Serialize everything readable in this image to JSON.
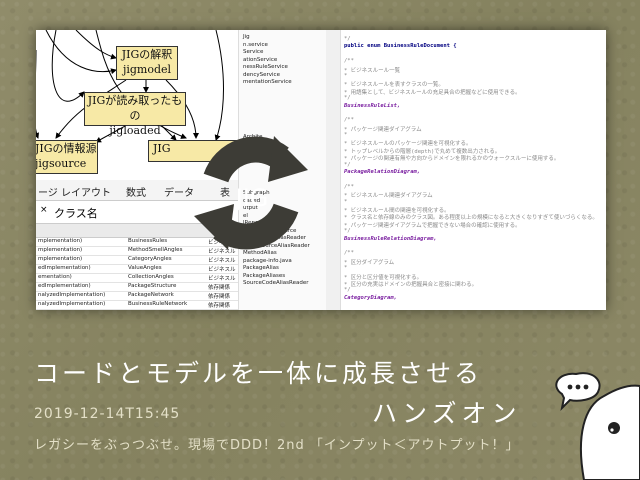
{
  "slide": {
    "title": "コードとモデルを一体に成長させる",
    "handson": "ハンズオン",
    "date": "2019-12-14T15:45",
    "subtitle": "レガシーをぶっつぶせ。現場でDDD！2nd 「インプット＜アウトプット！」",
    "logo_text": "JIG",
    "logo_color": "#3d3c36"
  },
  "diagram": {
    "nodes": [
      "JIGの解釈",
      "jigmodel",
      "JIGが読み取ったもの",
      "jigloaded",
      "JIGの情報源",
      "jigsource",
      "JIG"
    ]
  },
  "excel": {
    "ribbon": [
      "ージ レイアウト",
      "数式",
      "データ",
      "表示"
    ],
    "namebox_text": "クラス名",
    "rows": [
      [
        "mplementation)",
        "BusinessRules",
        "ビジネスル"
      ],
      [
        "mplementation)",
        "MethodSmellAngles",
        "ビジネスル"
      ],
      [
        "mplementation)",
        "CategoryAngles",
        "ビジネスル"
      ],
      [
        "edImplementation)",
        "ValueAngles",
        "ビジネスル"
      ],
      [
        "ementation)",
        "CollectionAngles",
        "ビジネスル"
      ],
      [
        "edImplementation)",
        "PackageStructure",
        "依存関係"
      ],
      [
        "nalyzedImplementation)",
        "PackageNetwork",
        "依存関係"
      ],
      [
        "nalyzedImplementation)",
        "BusinessRuleNetwork",
        "依存関係"
      ]
    ]
  },
  "tree": {
    "top": [
      "Jig",
      "n.service",
      "Service",
      "ationService",
      "nessRuleService",
      "dencyService",
      "mentationService"
    ],
    "middle": [
      "Archite",
      "BusinessRu",
      "DotText"
    ],
    "bottom": [
      "Subgraph",
      "oaded",
      "utput",
      "el",
      "lRepository",
      "JavadocAliasSource",
      "JavaSourceAliasReader",
      "KotlinSourceAliasReader",
      "MethodAlias",
      "package-info.java",
      "PackageAlias",
      "PackageAliases",
      "SourceCodeAliasReader"
    ]
  },
  "code": {
    "lines": [
      {
        "t": "*/",
        "c": "cm"
      },
      {
        "t": "public enum BusinessRuleDocument {",
        "c": "kw"
      },
      {
        "t": "",
        "c": ""
      },
      {
        "t": "/**",
        "c": "cm"
      },
      {
        "t": " * ビジネスルール一覧",
        "c": "cm"
      },
      {
        "t": " *",
        "c": "cm"
      },
      {
        "t": " * ビジネスルールを表すクラスの一覧。",
        "c": "cm"
      },
      {
        "t": " * 用語集として、ビジネスルールの充足具合の把握などに使用できる。",
        "c": "cm"
      },
      {
        "t": " */",
        "c": "cm"
      },
      {
        "t": "BusinessRuleList,",
        "c": "it"
      },
      {
        "t": "",
        "c": ""
      },
      {
        "t": "/**",
        "c": "cm"
      },
      {
        "t": " * パッケージ関連ダイアグラム",
        "c": "cm"
      },
      {
        "t": " *",
        "c": "cm"
      },
      {
        "t": " * ビジネスルールのパッケージ関連を可視化する。",
        "c": "cm"
      },
      {
        "t": " * トップレベルからの階層(depth)で丸めて複数出力される。",
        "c": "cm"
      },
      {
        "t": " * パッケージの関連有無や方向からドメインを限れるかのウォークスルーに使用する。",
        "c": "cm"
      },
      {
        "t": " */",
        "c": "cm"
      },
      {
        "t": "PackageRelationDiagram,",
        "c": "it"
      },
      {
        "t": "",
        "c": ""
      },
      {
        "t": "/**",
        "c": "cm"
      },
      {
        "t": " * ビジネスルール関連ダイアグラム",
        "c": "cm"
      },
      {
        "t": " *",
        "c": "cm"
      },
      {
        "t": " * ビジネスルール間の関連を可視化する。",
        "c": "cm"
      },
      {
        "t": " * クラス名と依存線のみのクラス図。ある程度以上の規模になると大きくなりすぎて使いづらくなる。",
        "c": "cm"
      },
      {
        "t": " * パッケージ関連ダイアグラムで把握できない場合の確認に使用する。",
        "c": "cm"
      },
      {
        "t": " */",
        "c": "cm"
      },
      {
        "t": "BusinessRuleRelationDiagram,",
        "c": "it"
      },
      {
        "t": "",
        "c": ""
      },
      {
        "t": "/**",
        "c": "cm"
      },
      {
        "t": " * 区分ダイアグラム",
        "c": "cm"
      },
      {
        "t": " *",
        "c": "cm"
      },
      {
        "t": " * 区分と区分値を可視化する。",
        "c": "cm"
      },
      {
        "t": " * 区分の充実はドメインの把握具合と密接に関わる。",
        "c": "cm"
      },
      {
        "t": " */",
        "c": "cm"
      },
      {
        "t": "CategoryDiagram,",
        "c": "it"
      }
    ]
  }
}
